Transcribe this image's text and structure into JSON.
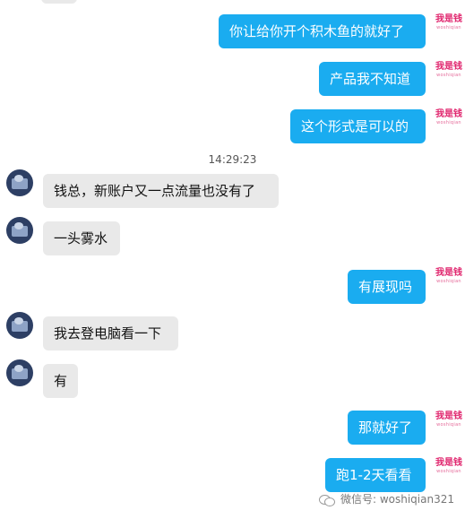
{
  "timestamp": "14:29:23",
  "logo": {
    "main": "我是钱",
    "sub": "woshiqian"
  },
  "watermark": "微信号: woshiqian321",
  "icons": {
    "watermark": "wechat-icon",
    "avatar": "user-avatar"
  },
  "colors": {
    "outgoing": "#1aacf0",
    "incoming": "#e9e9e9",
    "logo": "#e0266e"
  },
  "messages": [
    {
      "dir": "out",
      "text": "你让给你开个积木鱼的就好了"
    },
    {
      "dir": "out",
      "text": "产品我不知道"
    },
    {
      "dir": "out",
      "text": "这个形式是可以的"
    },
    {
      "dir": "in",
      "text": "钱总，新账户又一点流量也没有了"
    },
    {
      "dir": "in",
      "text": "一头雾水"
    },
    {
      "dir": "out",
      "text": "有展现吗"
    },
    {
      "dir": "in",
      "text": "我去登电脑看一下"
    },
    {
      "dir": "in",
      "text": "有"
    },
    {
      "dir": "out",
      "text": "那就好了"
    },
    {
      "dir": "out",
      "text": "跑1-2天看看"
    }
  ]
}
